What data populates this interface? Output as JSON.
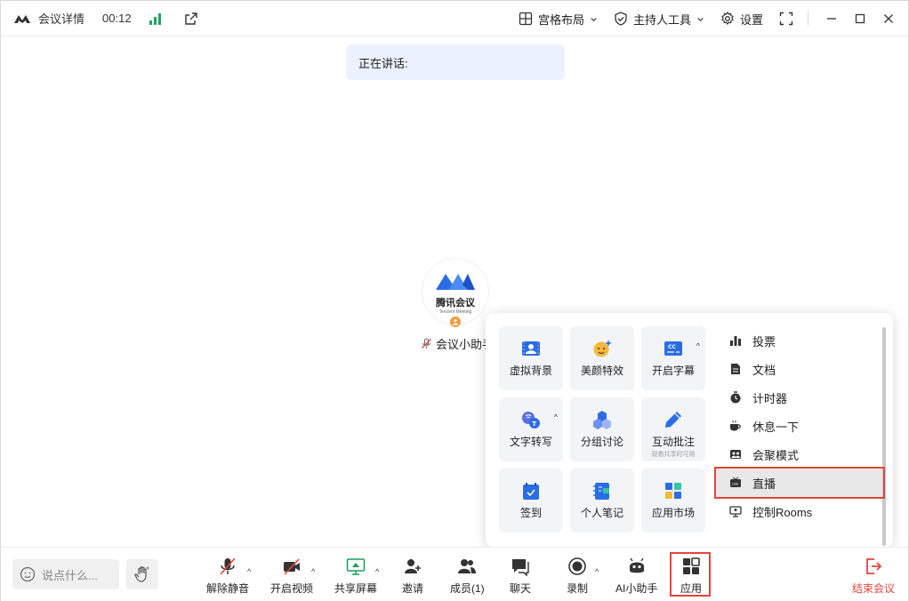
{
  "topbar": {
    "title": "会议详情",
    "timer": "00:12",
    "layout_label": "宫格布局",
    "host_tools_label": "主持人工具",
    "settings_label": "设置"
  },
  "speaking": {
    "label": "正在讲话:"
  },
  "participant": {
    "avatar_cn": "腾讯会议",
    "avatar_en": "Tencent Meeting",
    "name": "会议小助手"
  },
  "apps_popup": {
    "tiles": [
      {
        "label": "虚拟背景",
        "icon": "virtual-background-icon"
      },
      {
        "label": "美颜特效",
        "icon": "beauty-icon"
      },
      {
        "label": "开启字幕",
        "icon": "captions-icon"
      },
      {
        "label": "文字转写",
        "icon": "transcribe-icon"
      },
      {
        "label": "分组讨论",
        "icon": "breakout-icon"
      },
      {
        "label": "互动批注",
        "sub": "观看共享时可用",
        "icon": "annotate-icon"
      },
      {
        "label": "签到",
        "icon": "checkin-icon"
      },
      {
        "label": "个人笔记",
        "icon": "notes-icon"
      },
      {
        "label": "应用市场",
        "icon": "app-market-icon"
      }
    ],
    "list": [
      {
        "label": "投票",
        "icon": "poll-icon"
      },
      {
        "label": "文档",
        "icon": "document-icon"
      },
      {
        "label": "计时器",
        "icon": "timer-icon"
      },
      {
        "label": "休息一下",
        "icon": "coffee-icon"
      },
      {
        "label": "会聚模式",
        "icon": "together-mode-icon"
      },
      {
        "label": "直播",
        "icon": "live-icon"
      },
      {
        "label": "控制Rooms",
        "icon": "rooms-icon"
      }
    ]
  },
  "bottombar": {
    "chat_placeholder": "说点什么...",
    "unmute": "解除静音",
    "video": "开启视频",
    "share": "共享屏幕",
    "invite": "邀请",
    "members": "成员(1)",
    "chat": "聊天",
    "record": "录制",
    "ai": "AI小助手",
    "apps": "应用",
    "end": "结束会议"
  },
  "colors": {
    "accent": "#2b6de5",
    "danger": "#e0463c",
    "signal": "#21a366",
    "badge": "#f29b38"
  }
}
